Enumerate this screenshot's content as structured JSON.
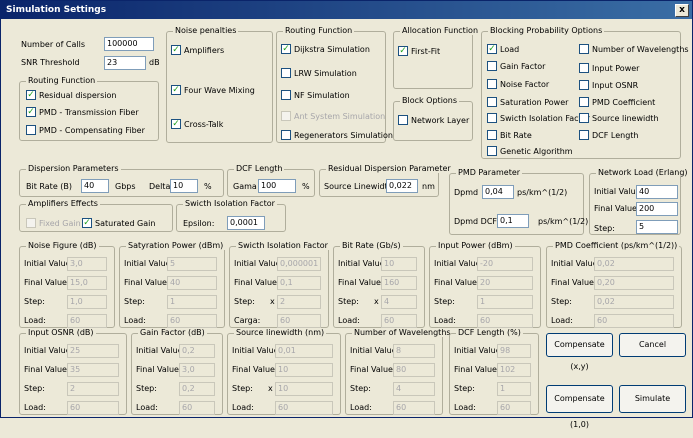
{
  "window": {
    "title": "Simulation Settings",
    "close_glyph": "x"
  },
  "top": {
    "calls_label": "Number of Calls",
    "calls_value": "100000",
    "snr_label": "SNR Threshold",
    "snr_value": "23",
    "snr_unit": "dB"
  },
  "routing_small": {
    "title": "Routing Function",
    "options": [
      {
        "label": "Residual dispersion",
        "checked": true
      },
      {
        "label": "PMD - Transmission Fiber",
        "checked": true
      },
      {
        "label": "PMD - Compensating Fiber",
        "checked": false
      }
    ]
  },
  "noise": {
    "title": "Noise penalties",
    "options": [
      {
        "label": "Amplifiers",
        "checked": true
      },
      {
        "label": "Four Wave Mixing",
        "checked": true
      },
      {
        "label": "Cross-Talk",
        "checked": true
      }
    ]
  },
  "routing": {
    "title": "Routing Function",
    "options": [
      {
        "label": "Dijkstra Simulation",
        "checked": true,
        "disabled": false
      },
      {
        "label": "LRW Simulation",
        "checked": false,
        "disabled": false
      },
      {
        "label": "NF Simulation",
        "checked": false,
        "disabled": false
      },
      {
        "label": "Ant System Simulation",
        "checked": false,
        "disabled": true
      },
      {
        "label": "Regenerators Simulation",
        "checked": false,
        "disabled": false
      }
    ]
  },
  "allocation": {
    "title": "Allocation Function",
    "option": {
      "label": "First-Fit",
      "checked": true
    }
  },
  "block_options": {
    "title": "Block Options",
    "option": {
      "label": "Network Layer",
      "checked": false
    }
  },
  "blocking": {
    "title": "Blocking Probability Options",
    "left": [
      {
        "label": "Load",
        "checked": true
      },
      {
        "label": "Gain Factor",
        "checked": false
      },
      {
        "label": "Noise Factor",
        "checked": false
      },
      {
        "label": "Saturation Power",
        "checked": false
      },
      {
        "label": "Swicth Isolation Factor",
        "checked": false
      },
      {
        "label": "Bit Rate",
        "checked": false
      },
      {
        "label": "Genetic Algorithm",
        "checked": false
      }
    ],
    "right": [
      {
        "label": "Number of Wavelengths",
        "checked": false
      },
      {
        "label": "Input Power",
        "checked": false
      },
      {
        "label": "Input OSNR",
        "checked": false
      },
      {
        "label": "PMD Coefficient",
        "checked": false
      },
      {
        "label": "Source linewidth",
        "checked": false
      },
      {
        "label": "DCF Length",
        "checked": false
      }
    ]
  },
  "dispersion": {
    "title": "Dispersion Parameters",
    "bitrate_label": "Bit Rate (B)",
    "bitrate_value": "40",
    "bitrate_unit": "Gbps",
    "delta_label": "Delta",
    "delta_value": "10",
    "delta_unit": "%"
  },
  "dcf_len": {
    "title": "DCF Length",
    "gama_label": "Gama",
    "gama_value": "100",
    "gama_unit": "%"
  },
  "residual": {
    "title": "Residual Dispersion Parameter",
    "label": "Source Linewidth",
    "value": "0,022",
    "unit": "nm"
  },
  "pmd": {
    "title": "PMD Parameter",
    "dpmd_label": "Dpmd",
    "dpmd_value": "0,04",
    "dpmd_unit": "ps/km^(1/2)",
    "dcf_label": "Dpmd DCF",
    "dcf_value": "0,1",
    "dcf_unit": "ps/km^(1/2)"
  },
  "netload": {
    "title": "Network Load (Erlang)",
    "initial_label": "Initial Value:",
    "initial_value": "40",
    "final_label": "Final Value:",
    "final_value": "200",
    "step_label": "Step:",
    "step_value": "5"
  },
  "amp": {
    "title": "Amplifiers Effects",
    "fixed": {
      "label": "Fixed Gain",
      "checked": false
    },
    "saturated": {
      "label": "Saturated Gain",
      "checked": true
    }
  },
  "switch": {
    "title": "Swicth Isolation Factor",
    "label": "Epsilon:",
    "value": "0,0001"
  },
  "row1": [
    {
      "title": "Noise Figure (dB)",
      "labels": [
        "Initial Value:",
        "Final Value:",
        "Step:",
        "Load:"
      ],
      "values": [
        "3,0",
        "15,0",
        "1,0",
        "60"
      ]
    },
    {
      "title": "Satyration Power (dBm)",
      "labels": [
        "Initial Value:",
        "Final Value:",
        "Step:",
        "Load:"
      ],
      "values": [
        "5",
        "40",
        "1",
        "60"
      ]
    },
    {
      "title": "Swicth Isolation Factor",
      "labels": [
        "Initial Value:",
        "Final Value:",
        "Step:",
        "Carga:"
      ],
      "values": [
        "0,000001",
        "0,1",
        "2",
        "60"
      ],
      "step_prefix": "x"
    },
    {
      "title": "Bit Rate (Gb/s)",
      "labels": [
        "Initial Value:",
        "Final Value:",
        "Step:",
        "Load:"
      ],
      "values": [
        "10",
        "160",
        "4",
        "60"
      ],
      "step_prefix": "x"
    },
    {
      "title": "Input Power (dBm)",
      "labels": [
        "Initial Value:",
        "Final Value:",
        "Step:",
        "Load:"
      ],
      "values": [
        "-20",
        "20",
        "1",
        "60"
      ]
    },
    {
      "title": "PMD Coefficient (ps/km^(1/2))",
      "labels": [
        "Initial Value:",
        "Final Value:",
        "Step:",
        "Load:"
      ],
      "values": [
        "0,02",
        "0,20",
        "0,02",
        "60"
      ]
    }
  ],
  "row2": [
    {
      "title": "Input OSNR (dB)",
      "labels": [
        "Initial Value:",
        "Final Value:",
        "Step:",
        "Load:"
      ],
      "values": [
        "25",
        "35",
        "2",
        "60"
      ]
    },
    {
      "title": "Gain Factor (dB)",
      "labels": [
        "Initial Value:",
        "Final Value:",
        "Step:",
        "Load:"
      ],
      "values": [
        "0,2",
        "3,0",
        "0,2",
        "60"
      ]
    },
    {
      "title": "Source linewidth (nm)",
      "labels": [
        "Initial Value:",
        "Final Value:",
        "Step:",
        "Load:"
      ],
      "values": [
        "0,01",
        "10",
        "10",
        "60"
      ],
      "step_prefix": "x"
    },
    {
      "title": "Number of Wavelengths",
      "labels": [
        "Initial Value:",
        "Final Value:",
        "Step:",
        "Load:"
      ],
      "values": [
        "8",
        "80",
        "4",
        "60"
      ]
    },
    {
      "title": "DCF Length (%)",
      "labels": [
        "Initial Value:",
        "Final Value:",
        "Step:",
        "Load:"
      ],
      "values": [
        "98",
        "102",
        "1",
        "60"
      ]
    }
  ],
  "buttons": {
    "compensate_xy": "Compensate (x,y)",
    "cancel": "Cancel",
    "compensate_10": "Compensate (1,0)",
    "simulate": "Simulate"
  }
}
